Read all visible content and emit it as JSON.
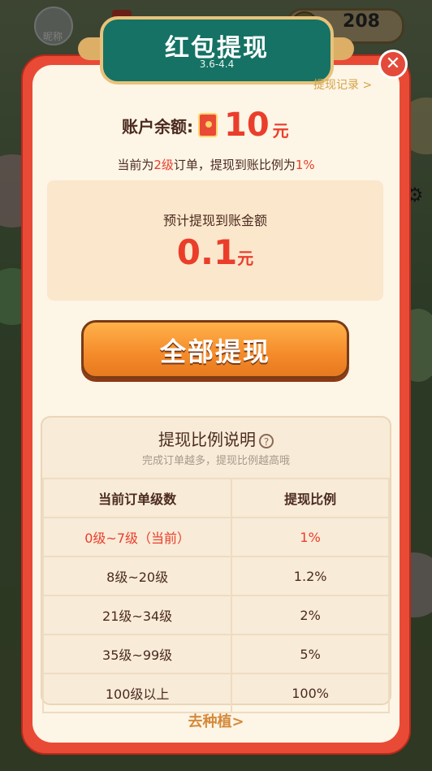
{
  "background": {
    "avatar_label": "昵称",
    "score": "208"
  },
  "modal": {
    "title": "红包提现",
    "subtitle": "3.6-4.4",
    "close_icon": "close-icon",
    "record_link": "提现记录 >",
    "balance_label": "账户余额:",
    "balance_value": "10",
    "balance_unit": "元",
    "level_prefix": "当前为",
    "level_value": "2级",
    "level_mid": "订单，提现到账比例为",
    "level_ratio": "1%",
    "expected_label": "预计提现到账金额",
    "expected_value": "0.1",
    "expected_unit": "元",
    "withdraw_button": "全部提现",
    "ratio_title": "提现比例说明",
    "ratio_subtitle": "完成订单越多，提现比例越高哦",
    "table": {
      "headers": [
        "当前订单级数",
        "提现比例"
      ],
      "rows": [
        {
          "level": "0级~7级（当前）",
          "ratio": "1%",
          "current": true
        },
        {
          "level": "8级~20级",
          "ratio": "1.2%"
        },
        {
          "level": "21级~34级",
          "ratio": "2%"
        },
        {
          "level": "35级~99级",
          "ratio": "5%"
        },
        {
          "level": "100级以上",
          "ratio": "100%"
        }
      ]
    },
    "plant_link": "去种植>"
  },
  "colors": {
    "accent_red": "#ea3e2b",
    "banner_green": "#157264",
    "button_orange": "#f48a2a"
  }
}
